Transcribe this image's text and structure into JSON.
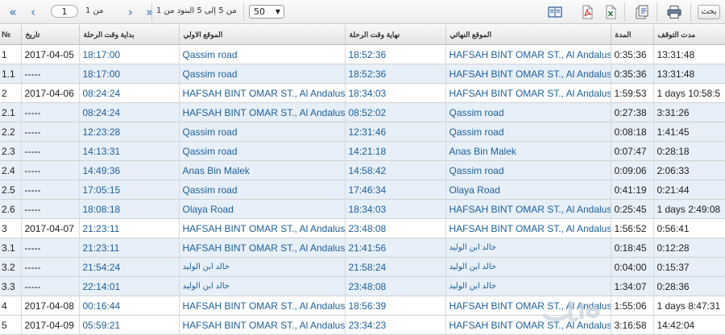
{
  "toolbar": {
    "search_label": "بحث",
    "pagination": {
      "page_value": "1",
      "of_label": "من 1",
      "range_label": "من 5 إلى 5 البنود من 1",
      "page_size": "50"
    }
  },
  "columns": {
    "no": "№",
    "date": "تاريخ",
    "start_time": "بداية وقت الرحلة",
    "start_location": "الموقع الاولي",
    "end_time": "نهاية وقت الرحلة",
    "end_location": "الموقع النهائي",
    "duration": "المدة",
    "stop_duration": "مدت التوقف"
  },
  "rows": [
    {
      "no": "1",
      "date": "2017-04-05",
      "start": "18:17:00",
      "from": "Qassim road",
      "end": "18:52:36",
      "to": "HAFSAH BINT OMAR ST., Al Andalus",
      "duration": "0:35:36",
      "stop": "13:31:48",
      "kind": "main"
    },
    {
      "no": "1.1",
      "date": "-----",
      "start": "18:17:00",
      "from": "Qassim road",
      "end": "18:52:36",
      "to": "HAFSAH BINT OMAR ST., Al Andalus",
      "duration": "0:35:36",
      "stop": "13:31:48",
      "kind": "sub"
    },
    {
      "no": "2",
      "date": "2017-04-06",
      "start": "08:24:24",
      "from": "HAFSAH BINT OMAR ST., Al Andalus",
      "end": "18:34:03",
      "to": "HAFSAH BINT OMAR ST., Al Andalus",
      "duration": "1:59:53",
      "stop": "1 days 10:58:5",
      "kind": "main"
    },
    {
      "no": "2.1",
      "date": "-----",
      "start": "08:24:24",
      "from": "HAFSAH BINT OMAR ST., Al Andalus",
      "end": "08:52:02",
      "to": "Qassim road",
      "duration": "0:27:38",
      "stop": "3:31:26",
      "kind": "sub"
    },
    {
      "no": "2.2",
      "date": "-----",
      "start": "12:23:28",
      "from": "Qassim road",
      "end": "12:31:46",
      "to": "Qassim road",
      "duration": "0:08:18",
      "stop": "1:41:45",
      "kind": "sub"
    },
    {
      "no": "2.3",
      "date": "-----",
      "start": "14:13:31",
      "from": "Qassim road",
      "end": "14:21:18",
      "to": "Anas Bin Malek",
      "duration": "0:07:47",
      "stop": "0:28:18",
      "kind": "sub"
    },
    {
      "no": "2.4",
      "date": "-----",
      "start": "14:49:36",
      "from": "Anas Bin Malek",
      "end": "14:58:42",
      "to": "Qassim road",
      "duration": "0:09:06",
      "stop": "2:06:33",
      "kind": "sub"
    },
    {
      "no": "2.5",
      "date": "-----",
      "start": "17:05:15",
      "from": "Qassim road",
      "end": "17:46:34",
      "to": "Olaya Road",
      "duration": "0:41:19",
      "stop": "0:21:44",
      "kind": "sub"
    },
    {
      "no": "2.6",
      "date": "-----",
      "start": "18:08:18",
      "from": "Olaya Road",
      "end": "18:34:03",
      "to": "HAFSAH BINT OMAR ST., Al Andalus",
      "duration": "0:25:45",
      "stop": "1 days 2:49:08",
      "kind": "sub"
    },
    {
      "no": "3",
      "date": "2017-04-07",
      "start": "21:23:11",
      "from": "HAFSAH BINT OMAR ST., Al Andalus",
      "end": "23:48:08",
      "to": "HAFSAH BINT OMAR ST., Al Andalus",
      "duration": "1:56:52",
      "stop": "0:56:41",
      "kind": "main"
    },
    {
      "no": "3.1",
      "date": "-----",
      "start": "21:23:11",
      "from": "HAFSAH BINT OMAR ST., Al Andalus",
      "end": "21:41:56",
      "to": "خالد ابن الوليد",
      "duration": "0:18:45",
      "stop": "0:12:28",
      "kind": "sub"
    },
    {
      "no": "3.2",
      "date": "-----",
      "start": "21:54:24",
      "from": "خالد ابن الوليد",
      "end": "21:58:24",
      "to": "خالد ابن الوليد",
      "duration": "0:04:00",
      "stop": "0:15:37",
      "kind": "sub"
    },
    {
      "no": "3.3",
      "date": "-----",
      "start": "22:14:01",
      "from": "خالد ابن الوليد",
      "end": "23:48:08",
      "to": "خالد ابن الوليد",
      "duration": "1:34:07",
      "stop": "0:28:36",
      "kind": "sub"
    },
    {
      "no": "4",
      "date": "2017-04-08",
      "start": "00:16:44",
      "from": "HAFSAH BINT OMAR ST., Al Andalus",
      "end": "18:56:39",
      "to": "HAFSAH BINT OMAR ST., Al Andalus",
      "duration": "1:55:06",
      "stop": "1 days 8:47:31",
      "kind": "main"
    },
    {
      "no": "5",
      "date": "2017-04-09",
      "start": "05:59:21",
      "from": "HAFSAH BINT OMAR ST., Al Andalus",
      "end": "23:34:23",
      "to": "HAFSAH BINT OMAR ST., Al Andalus",
      "duration": "3:16:58",
      "stop": "14:42:04",
      "kind": "main"
    }
  ],
  "icons": {
    "first": "double-chevron-left-icon",
    "prev": "chevron-left-icon",
    "next": "chevron-right-icon",
    "last": "double-chevron-right-icon",
    "export_html": "html-export-icon",
    "export_pdf": "pdf-export-icon",
    "export_excel": "excel-export-icon",
    "export_word": "word-export-icon",
    "print": "print-icon"
  },
  "colors": {
    "link_blue": "#1d5f9e",
    "sub_row_bg": "#e7eff8",
    "pager_blue": "#2a6ebb"
  }
}
